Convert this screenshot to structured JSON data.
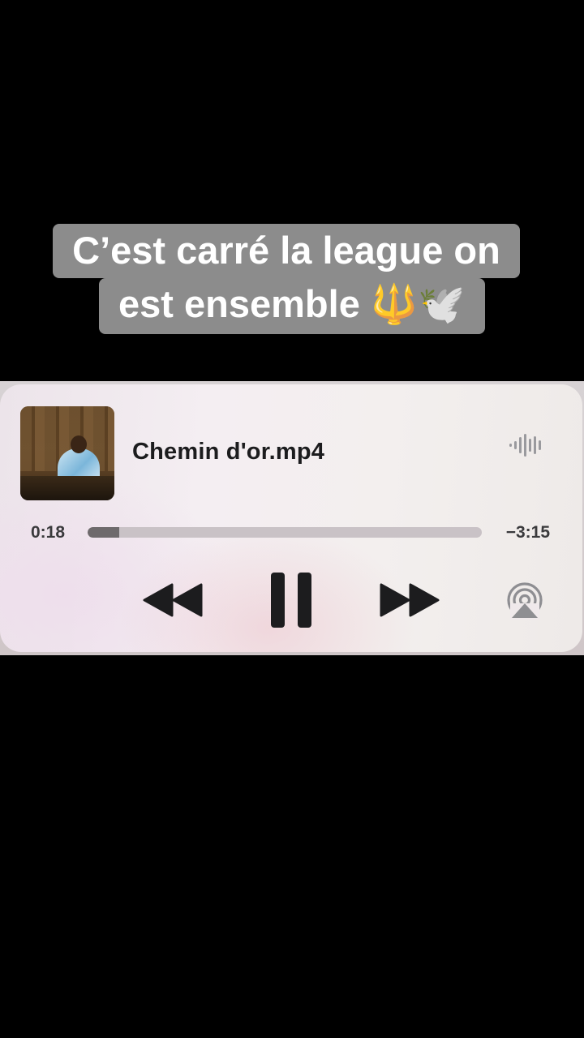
{
  "caption": {
    "line1": "C’est carré la league on",
    "line2": "est ensemble 🔱🕊️"
  },
  "player": {
    "track_title": "Chemin d'or.mp4",
    "time_elapsed": "0:18",
    "time_remaining": "−3:15",
    "progress_fraction": 0.08,
    "artwork_icon": "album-artwork-image",
    "waveform_icon": "waveform-icon",
    "controls": {
      "rewind_icon": "rewind-icon",
      "pause_icon": "pause-icon",
      "forward_icon": "fast-forward-icon",
      "airplay_icon": "airplay-icon"
    },
    "colors": {
      "control_glyph": "#1c1c1e",
      "progress_fill": "#6e6a6c",
      "progress_track": "#c9c2c6",
      "caption_bg": "#8c8c8c"
    }
  }
}
